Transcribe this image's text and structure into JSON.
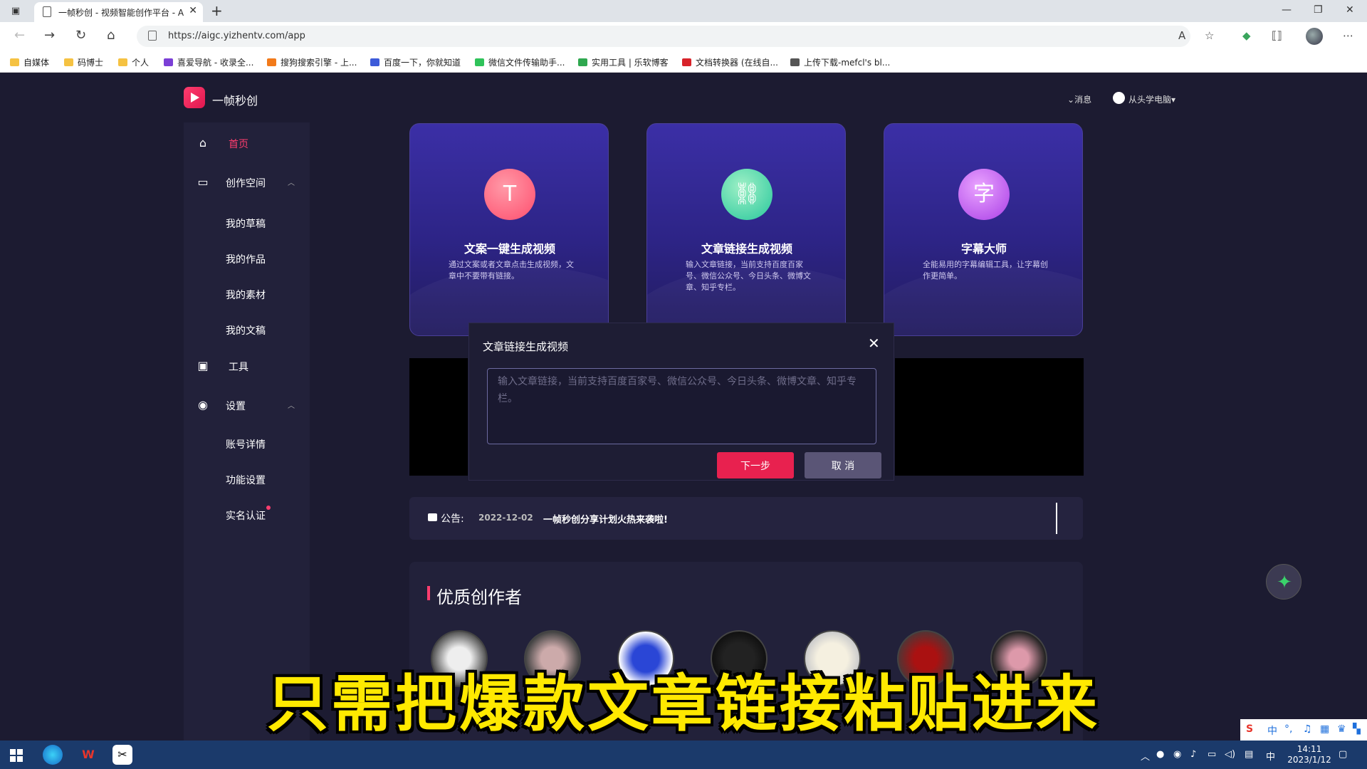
{
  "browser": {
    "tab_title": "一帧秒创 - 视频智能创作平台 - A",
    "url": "https://aigc.yizhentv.com/app",
    "bookmarks": [
      {
        "label": "自媒体",
        "color": "#f5c242"
      },
      {
        "label": "码博士",
        "color": "#f5c242"
      },
      {
        "label": "个人",
        "color": "#f5c242"
      },
      {
        "label": "喜爱导航 - 收录全...",
        "color": "#7b3fd6"
      },
      {
        "label": "搜狗搜索引擎 - 上...",
        "color": "#f27a1a"
      },
      {
        "label": "百度一下，你就知道",
        "color": "#3d5bd9"
      },
      {
        "label": "微信文件传输助手...",
        "color": "#2fc35a"
      },
      {
        "label": "实用工具 | 乐软博客",
        "color": "#2fa84f"
      },
      {
        "label": "文档转换器 (在线自...",
        "color": "#d8232a"
      },
      {
        "label": "上传下载-mefcl's bl...",
        "color": "#555555"
      }
    ]
  },
  "header": {
    "brand": "一帧秒创",
    "messages": "消息",
    "user": "从头学电脑"
  },
  "sidebar": {
    "home": "首页",
    "creation_space": "创作空间",
    "creation_items": [
      "我的草稿",
      "我的作品",
      "我的素材",
      "我的文稿"
    ],
    "tools": "工具",
    "settings": "设置",
    "settings_items": [
      "账号详情",
      "功能设置",
      "实名认证"
    ]
  },
  "cards": [
    {
      "title": "文案一键生成视频",
      "desc": "通过文案或者文章点击生成视频，文章中不要带有链接。",
      "icon": "text-icon",
      "color": "#ff5b7a"
    },
    {
      "title": "文章链接生成视频",
      "desc": "输入文章链接，当前支持百度百家号、微信公众号、今日头条、微博文章、知乎专栏。",
      "icon": "link-icon",
      "color": "#2bd3a6"
    },
    {
      "title": "字幕大师",
      "desc": "全能易用的字幕编辑工具，让字幕创作更简单。",
      "icon": "subtitle-icon",
      "color": "#c24de8"
    }
  ],
  "modal": {
    "title": "文章链接生成视频",
    "placeholder": "输入文章链接，当前支持百度百家号、微信公众号、今日头条、微博文章、知乎专栏。",
    "value": "",
    "next": "下一步",
    "cancel": "取 消"
  },
  "notice": {
    "label": "公告:",
    "date": "2022-12-02",
    "text": "一帧秒创分享计划火热来袭啦!"
  },
  "creators": {
    "title": "优质创作者",
    "avatar_count": 7
  },
  "caption": "只需把爆款文章链接粘贴进来",
  "taskbar": {
    "time": "14:11",
    "date": "2023/1/12",
    "ime_lang": "中"
  }
}
